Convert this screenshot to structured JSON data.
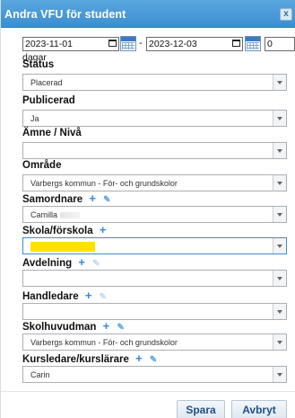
{
  "dialog": {
    "title": "Andra VFU för student",
    "close_label": "x"
  },
  "dates": {
    "from": "2023-11-01",
    "to": "2023-12-03",
    "separator": "-",
    "days": "0",
    "days_label": "dagar"
  },
  "fields": {
    "status": {
      "label": "Status",
      "value": "Placerad"
    },
    "publicerad": {
      "label": "Publicerad",
      "value": "Ja"
    },
    "amne": {
      "label": "Ämne / Nivå",
      "value": ""
    },
    "omrade": {
      "label": "Område",
      "value": "Varbergs kommun - För- och grundskolor"
    },
    "samordnare": {
      "label": "Samordnare",
      "value": "Camilla"
    },
    "skola": {
      "label": "Skola/förskola",
      "value": ""
    },
    "avdelning": {
      "label": "Avdelning",
      "value": ""
    },
    "handledare": {
      "label": "Handledare",
      "value": ""
    },
    "skolhuvudman": {
      "label": "Skolhuvudman",
      "value": "Varbergs kommun - För- och grundskolor"
    },
    "kursledare": {
      "label": "Kursledare/kurslärare",
      "value": "Carin"
    }
  },
  "buttons": {
    "save": "Spara",
    "cancel": "Avbryt"
  },
  "icons": {
    "plus": "+",
    "pencil": "✎"
  },
  "colors": {
    "titlebar": "#3b8fd0",
    "accent": "#2f8ae0",
    "highlight": "#ffe100"
  }
}
